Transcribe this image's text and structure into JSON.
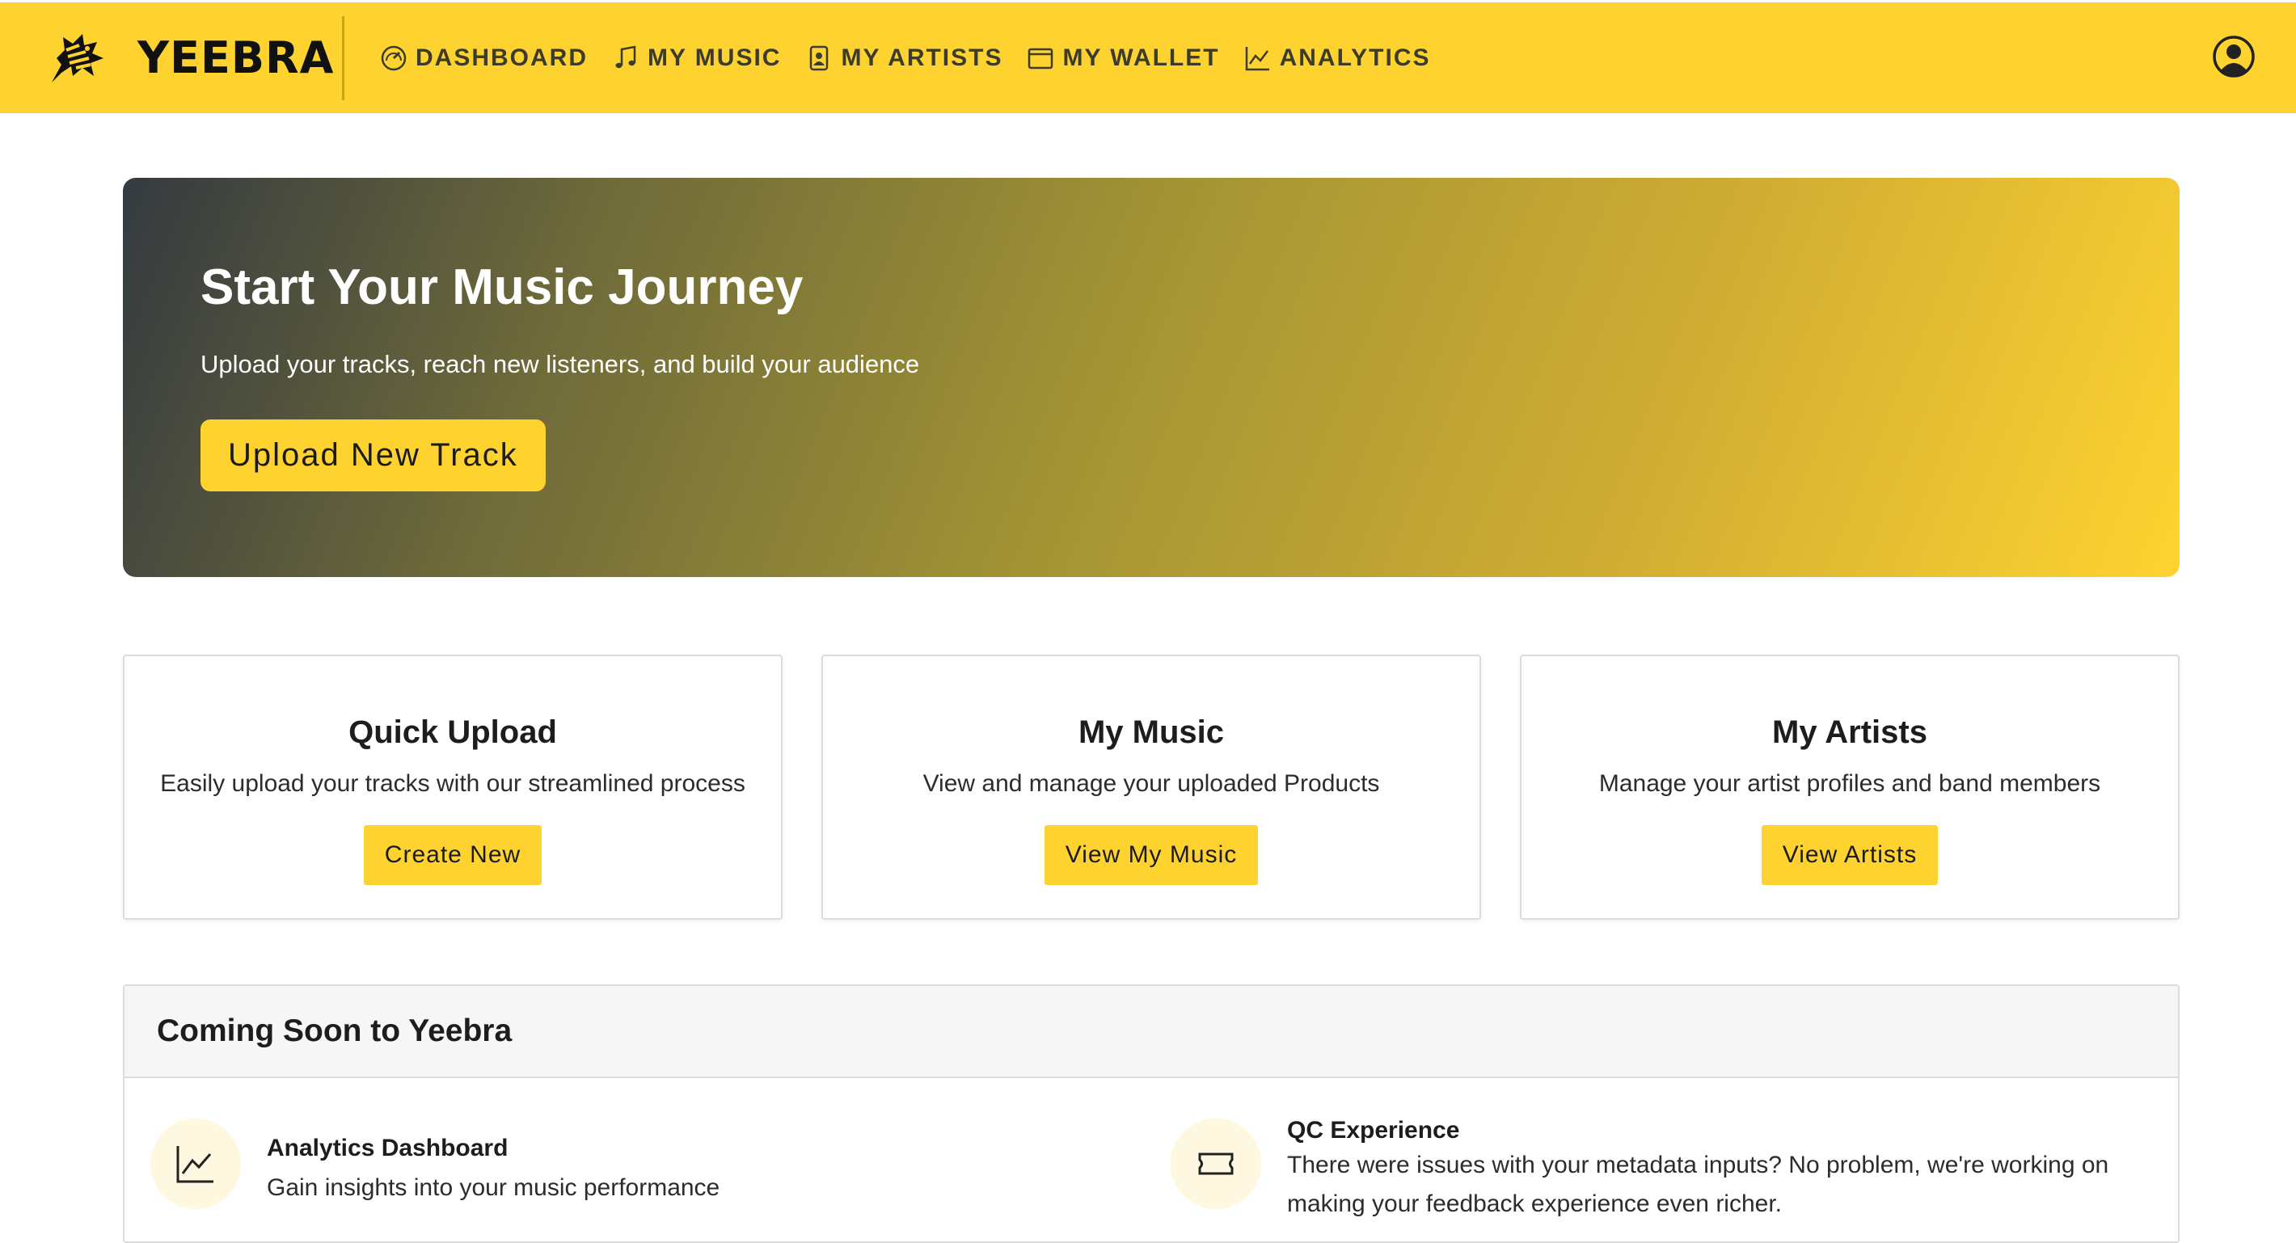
{
  "brand": {
    "name": "YEEBRA"
  },
  "nav": {
    "items": [
      {
        "label": "DASHBOARD",
        "icon": "speedometer-icon"
      },
      {
        "label": "MY MUSIC",
        "icon": "music-note-icon"
      },
      {
        "label": "MY ARTISTS",
        "icon": "artist-card-icon"
      },
      {
        "label": "MY WALLET",
        "icon": "wallet-icon"
      },
      {
        "label": "ANALYTICS",
        "icon": "line-chart-icon"
      }
    ],
    "user_icon": "user-circle-icon"
  },
  "hero": {
    "title": "Start Your Music Journey",
    "subtitle": "Upload your tracks, reach new listeners, and build your audience",
    "button_label": "Upload New Track"
  },
  "cards": [
    {
      "title": "Quick Upload",
      "text": "Easily upload your tracks with our streamlined process",
      "button_label": "Create New"
    },
    {
      "title": "My Music",
      "text": "View and manage your uploaded Products",
      "button_label": "View My Music"
    },
    {
      "title": "My Artists",
      "text": "Manage your artist profiles and band members",
      "button_label": "View Artists"
    }
  ],
  "coming_soon": {
    "title": "Coming Soon to Yeebra",
    "features": [
      {
        "title": "Analytics Dashboard",
        "description": "Gain insights into your music performance",
        "icon": "line-chart-icon"
      },
      {
        "title": "QC Experience",
        "description_line1": "There were issues with your metadata inputs? No problem, we're working on",
        "description_line2": "making your feedback experience even richer.",
        "icon": "ticket-icon"
      }
    ]
  },
  "colors": {
    "accent": "#fed330",
    "hero_start": "#343a40",
    "text_dark": "#1d1d1d"
  }
}
